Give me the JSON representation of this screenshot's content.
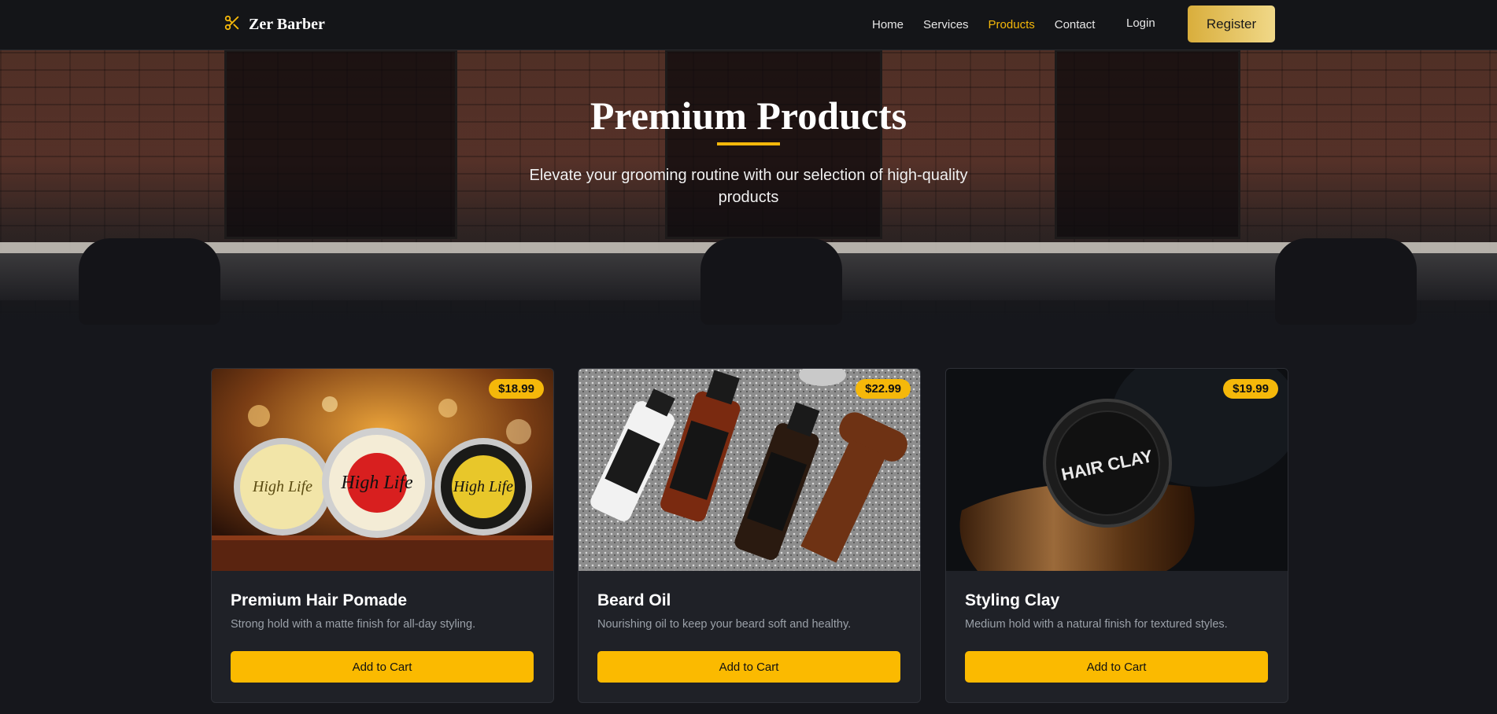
{
  "nav": {
    "brand": "Zer Barber",
    "links": [
      "Home",
      "Services",
      "Products",
      "Contact"
    ],
    "active_link": "Products",
    "login": "Login",
    "register": "Register"
  },
  "hero": {
    "title": "Premium Products",
    "subtitle": "Elevate your grooming routine with our selection of high-quality products"
  },
  "products": [
    {
      "title": "Premium Hair Pomade",
      "description": "Strong hold with a matte finish for all-day styling.",
      "price": "$18.99",
      "cta": "Add to Cart",
      "jar_labels": [
        "High Life",
        "High Life",
        "High Life"
      ]
    },
    {
      "title": "Beard Oil",
      "description": "Nourishing oil to keep your beard soft and healthy.",
      "price": "$22.99",
      "cta": "Add to Cart"
    },
    {
      "title": "Styling Clay",
      "description": "Medium hold with a natural finish for textured styles.",
      "price": "$19.99",
      "cta": "Add to Cart",
      "jar_label": "HAIR CLAY"
    }
  ],
  "colors": {
    "accent": "#f5b80a",
    "background": "#16171c",
    "card": "#1f2127"
  }
}
